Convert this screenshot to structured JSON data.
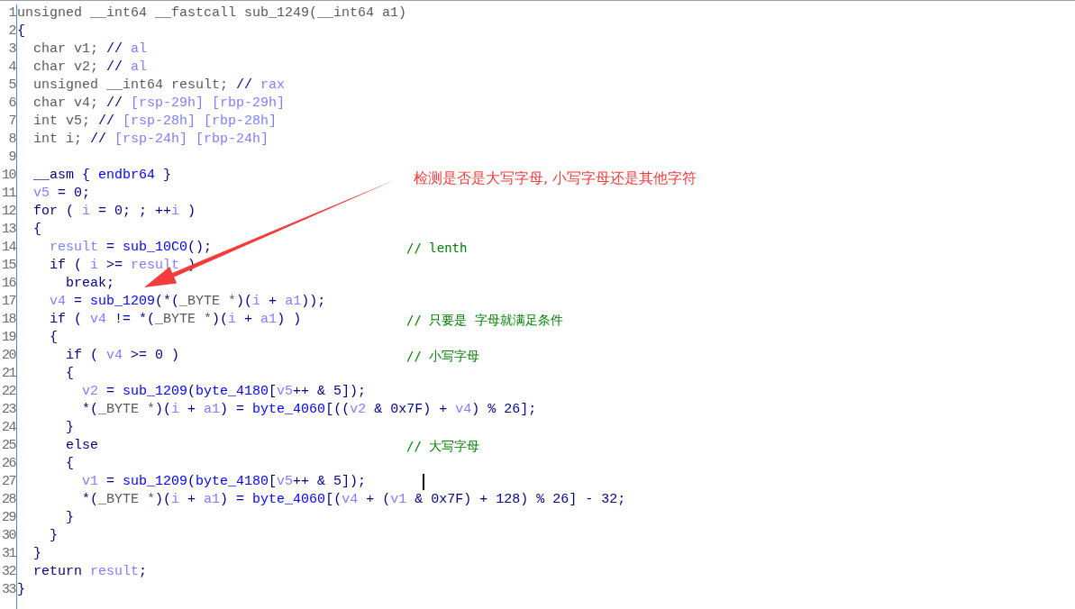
{
  "annotation": {
    "text": "检测是否是大写字母, 小写字母还是其他字符"
  },
  "lines": [
    {
      "number": "1",
      "tokens": [
        {
          "kind": "decl",
          "text": "unsigned __int64 __fastcall sub_1249(__int64 a1)"
        }
      ]
    },
    {
      "number": "2",
      "tokens": [
        {
          "kind": "plain",
          "text": "{"
        }
      ]
    },
    {
      "number": "3",
      "tokens": [
        {
          "kind": "decl",
          "text": "  char v1; "
        },
        {
          "kind": "plain",
          "text": "// "
        },
        {
          "kind": "var",
          "text": "al"
        }
      ]
    },
    {
      "number": "4",
      "tokens": [
        {
          "kind": "decl",
          "text": "  char v2; "
        },
        {
          "kind": "plain",
          "text": "// "
        },
        {
          "kind": "var",
          "text": "al"
        }
      ]
    },
    {
      "number": "5",
      "tokens": [
        {
          "kind": "decl",
          "text": "  unsigned __int64 result; "
        },
        {
          "kind": "plain",
          "text": "// "
        },
        {
          "kind": "var",
          "text": "rax"
        }
      ]
    },
    {
      "number": "6",
      "tokens": [
        {
          "kind": "decl",
          "text": "  char v4; "
        },
        {
          "kind": "plain",
          "text": "// "
        },
        {
          "kind": "var",
          "text": "[rsp-29h] [rbp-29h]"
        }
      ]
    },
    {
      "number": "7",
      "tokens": [
        {
          "kind": "decl",
          "text": "  int v5; "
        },
        {
          "kind": "plain",
          "text": "// "
        },
        {
          "kind": "var",
          "text": "[rsp-28h] [rbp-28h]"
        }
      ]
    },
    {
      "number": "8",
      "tokens": [
        {
          "kind": "decl",
          "text": "  int i; "
        },
        {
          "kind": "plain",
          "text": "// "
        },
        {
          "kind": "var",
          "text": "[rsp-24h] [rbp-24h]"
        }
      ]
    },
    {
      "number": "9"
    },
    {
      "number": "10",
      "tokens": [
        {
          "kind": "plain",
          "text": "  __asm { "
        },
        {
          "kind": "func",
          "text": "endbr64"
        },
        {
          "kind": "plain",
          "text": " }"
        }
      ]
    },
    {
      "number": "11",
      "tokens": [
        {
          "kind": "var",
          "text": "  v5"
        },
        {
          "kind": "plain",
          "text": " = 0;"
        }
      ]
    },
    {
      "number": "12",
      "tokens": [
        {
          "kind": "plain",
          "text": "  for ( "
        },
        {
          "kind": "var",
          "text": "i"
        },
        {
          "kind": "plain",
          "text": " = 0; ; ++"
        },
        {
          "kind": "var",
          "text": "i"
        },
        {
          "kind": "plain",
          "text": " )"
        }
      ]
    },
    {
      "number": "13",
      "tokens": [
        {
          "kind": "plain",
          "text": "  {"
        }
      ]
    },
    {
      "number": "14",
      "tokens": [
        {
          "kind": "var",
          "text": "    result"
        },
        {
          "kind": "plain",
          "text": " = "
        },
        {
          "kind": "func",
          "text": "sub_10C0"
        },
        {
          "kind": "plain",
          "text": "();"
        }
      ],
      "comment": "// lenth"
    },
    {
      "number": "15",
      "tokens": [
        {
          "kind": "plain",
          "text": "    if ( "
        },
        {
          "kind": "var",
          "text": "i"
        },
        {
          "kind": "plain",
          "text": " >= "
        },
        {
          "kind": "var",
          "text": "result"
        },
        {
          "kind": "plain",
          "text": " )"
        }
      ]
    },
    {
      "number": "16",
      "tokens": [
        {
          "kind": "plain",
          "text": "      break;"
        }
      ]
    },
    {
      "number": "17",
      "tokens": [
        {
          "kind": "var",
          "text": "    v4"
        },
        {
          "kind": "plain",
          "text": " = "
        },
        {
          "kind": "func",
          "text": "sub_1209"
        },
        {
          "kind": "plain",
          "text": "(*("
        },
        {
          "kind": "decl",
          "text": "_BYTE *"
        },
        {
          "kind": "plain",
          "text": ")("
        },
        {
          "kind": "var",
          "text": "i"
        },
        {
          "kind": "plain",
          "text": " + "
        },
        {
          "kind": "var",
          "text": "a1"
        },
        {
          "kind": "plain",
          "text": "));"
        }
      ]
    },
    {
      "number": "18",
      "tokens": [
        {
          "kind": "plain",
          "text": "    if ( "
        },
        {
          "kind": "var",
          "text": "v4"
        },
        {
          "kind": "plain",
          "text": " != *("
        },
        {
          "kind": "decl",
          "text": "_BYTE *"
        },
        {
          "kind": "plain",
          "text": ")("
        },
        {
          "kind": "var",
          "text": "i"
        },
        {
          "kind": "plain",
          "text": " + "
        },
        {
          "kind": "var",
          "text": "a1"
        },
        {
          "kind": "plain",
          "text": ") )"
        }
      ],
      "comment": "// 只要是 字母就满足条件"
    },
    {
      "number": "19",
      "tokens": [
        {
          "kind": "plain",
          "text": "    {"
        }
      ]
    },
    {
      "number": "20",
      "tokens": [
        {
          "kind": "plain",
          "text": "      if ( "
        },
        {
          "kind": "var",
          "text": "v4"
        },
        {
          "kind": "plain",
          "text": " >= 0 )"
        }
      ],
      "comment": "// 小写字母"
    },
    {
      "number": "21",
      "tokens": [
        {
          "kind": "plain",
          "text": "      {"
        }
      ]
    },
    {
      "number": "22",
      "tokens": [
        {
          "kind": "var",
          "text": "        v2"
        },
        {
          "kind": "plain",
          "text": " = "
        },
        {
          "kind": "func",
          "text": "sub_1209"
        },
        {
          "kind": "plain",
          "text": "("
        },
        {
          "kind": "func",
          "text": "byte_4180"
        },
        {
          "kind": "plain",
          "text": "["
        },
        {
          "kind": "var",
          "text": "v5"
        },
        {
          "kind": "plain",
          "text": "++ & 5]);"
        }
      ]
    },
    {
      "number": "23",
      "tokens": [
        {
          "kind": "plain",
          "text": "        *("
        },
        {
          "kind": "decl",
          "text": "_BYTE *"
        },
        {
          "kind": "plain",
          "text": ")("
        },
        {
          "kind": "var",
          "text": "i"
        },
        {
          "kind": "plain",
          "text": " + "
        },
        {
          "kind": "var",
          "text": "a1"
        },
        {
          "kind": "plain",
          "text": ") = "
        },
        {
          "kind": "func",
          "text": "byte_4060"
        },
        {
          "kind": "plain",
          "text": "[(("
        },
        {
          "kind": "var",
          "text": "v2"
        },
        {
          "kind": "plain",
          "text": " & 0x7F) + "
        },
        {
          "kind": "var",
          "text": "v4"
        },
        {
          "kind": "plain",
          "text": ") % 26];"
        }
      ]
    },
    {
      "number": "24",
      "tokens": [
        {
          "kind": "plain",
          "text": "      }"
        }
      ]
    },
    {
      "number": "25",
      "tokens": [
        {
          "kind": "plain",
          "text": "      else"
        }
      ],
      "comment": "// 大写字母"
    },
    {
      "number": "26",
      "tokens": [
        {
          "kind": "plain",
          "text": "      {"
        }
      ]
    },
    {
      "number": "27",
      "tokens": [
        {
          "kind": "var",
          "text": "        v1"
        },
        {
          "kind": "plain",
          "text": " = "
        },
        {
          "kind": "func",
          "text": "sub_1209"
        },
        {
          "kind": "plain",
          "text": "("
        },
        {
          "kind": "func",
          "text": "byte_4180"
        },
        {
          "kind": "plain",
          "text": "["
        },
        {
          "kind": "var",
          "text": "v5"
        },
        {
          "kind": "plain",
          "text": "++ & 5]);"
        }
      ]
    },
    {
      "number": "28",
      "tokens": [
        {
          "kind": "plain",
          "text": "        *("
        },
        {
          "kind": "decl",
          "text": "_BYTE *"
        },
        {
          "kind": "plain",
          "text": ")("
        },
        {
          "kind": "var",
          "text": "i"
        },
        {
          "kind": "plain",
          "text": " + "
        },
        {
          "kind": "var",
          "text": "a1"
        },
        {
          "kind": "plain",
          "text": ") = "
        },
        {
          "kind": "func",
          "text": "byte_4060"
        },
        {
          "kind": "plain",
          "text": "[("
        },
        {
          "kind": "var",
          "text": "v4"
        },
        {
          "kind": "plain",
          "text": " + ("
        },
        {
          "kind": "var",
          "text": "v1"
        },
        {
          "kind": "plain",
          "text": " & 0x7F) + 128) % 26] - 32;"
        }
      ]
    },
    {
      "number": "29",
      "tokens": [
        {
          "kind": "plain",
          "text": "      }"
        }
      ]
    },
    {
      "number": "30",
      "tokens": [
        {
          "kind": "plain",
          "text": "    }"
        }
      ]
    },
    {
      "number": "31",
      "tokens": [
        {
          "kind": "plain",
          "text": "  }"
        }
      ]
    },
    {
      "number": "32",
      "tokens": [
        {
          "kind": "plain",
          "text": "  return "
        },
        {
          "kind": "var",
          "text": "result"
        },
        {
          "kind": "plain",
          "text": ";"
        }
      ]
    },
    {
      "number": "33",
      "tokens": [
        {
          "kind": "plain",
          "text": "}"
        }
      ]
    }
  ]
}
